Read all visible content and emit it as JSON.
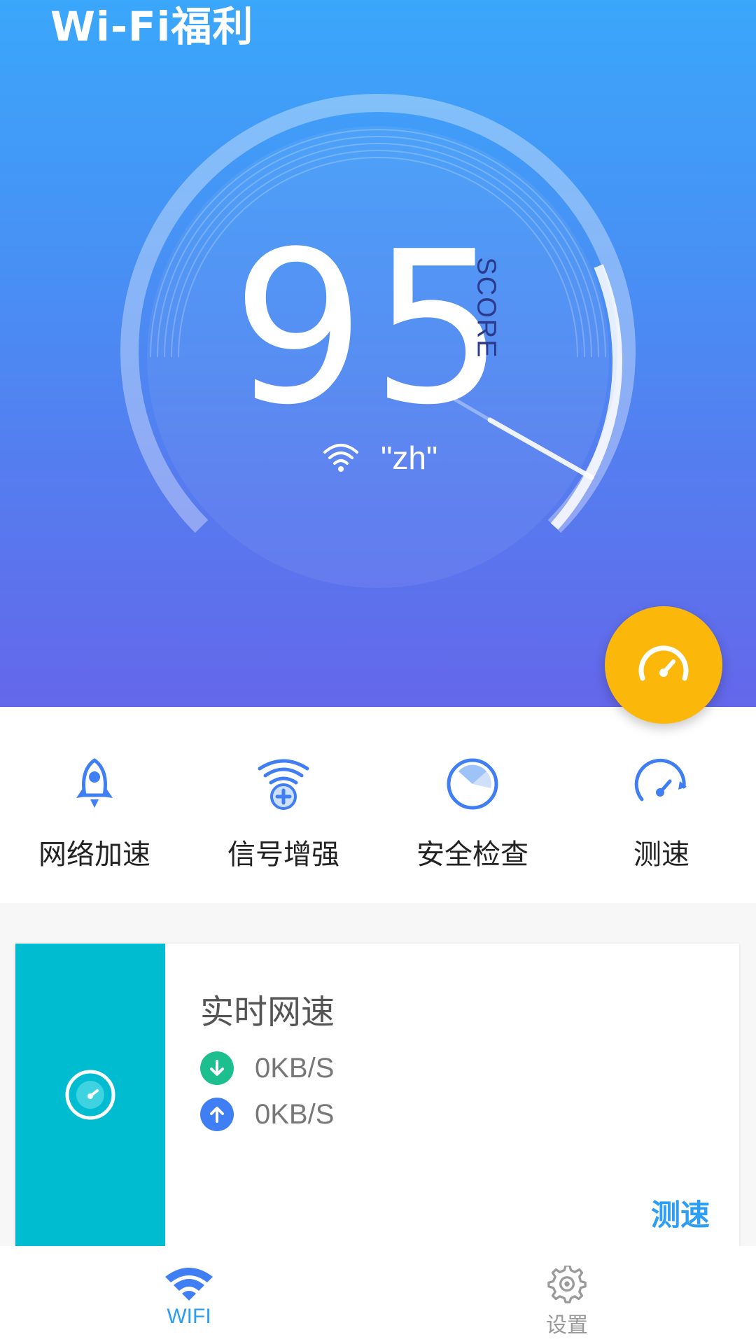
{
  "header": {
    "title": "Wi-Fi福利"
  },
  "score": {
    "value": "95",
    "label": "SCORE",
    "ssid": "\"zh\"",
    "level": 0.95
  },
  "fab": {
    "icon": "speedometer-icon"
  },
  "actions": [
    {
      "label": "网络加速",
      "icon": "rocket-icon"
    },
    {
      "label": "信号增强",
      "icon": "wifi-plus-icon"
    },
    {
      "label": "安全检查",
      "icon": "shield-radar-icon"
    },
    {
      "label": "测速",
      "icon": "speedometer-icon"
    }
  ],
  "speed_card": {
    "title": "实时网速",
    "download": "0KB/S",
    "upload": "0KB/S",
    "action": "测速"
  },
  "tabs": [
    {
      "label": "WIFI",
      "icon": "wifi-icon",
      "active": true
    },
    {
      "label": "设置",
      "icon": "gear-icon",
      "active": false
    }
  ],
  "colors": {
    "hero_top": "#3aa7fb",
    "hero_bottom": "#6467ea",
    "fab": "#fbb80a",
    "accent": "#2c9ef4",
    "card_side": "#00bcd0",
    "download": "#1ebf8e",
    "upload": "#3f7ef3"
  }
}
